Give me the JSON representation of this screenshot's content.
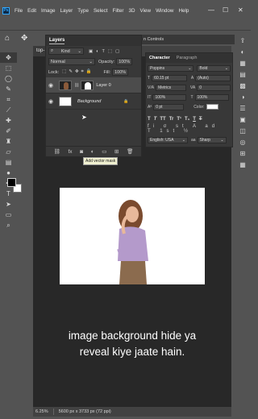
{
  "menubar": {
    "logo": "Ps",
    "items": [
      "File",
      "Edit",
      "Image",
      "Layer",
      "Type",
      "Select",
      "Filter",
      "3D",
      "View",
      "Window",
      "Help"
    ],
    "controls": [
      "—",
      "☐",
      "✕"
    ]
  },
  "optionsbar": {
    "icons": [
      "home-icon",
      "move-icon"
    ],
    "show_controls": "n Controls"
  },
  "document": {
    "tab_label": "top-",
    "caption_line1": "image background hide ya",
    "caption_line2": "reveal kiye jaate hain.",
    "zoom": "6.25%",
    "doc_info": "5600 px x 3733 px (72 ppi)"
  },
  "layers_panel": {
    "title": "Layers",
    "kind_label": "Kind",
    "blend_mode": "Normal",
    "opacity_label": "Opacity:",
    "opacity_value": "100%",
    "lock_label": "Lock:",
    "fill_label": "Fill:",
    "fill_value": "100%",
    "layers": [
      {
        "name": "Layer 0",
        "selected": true,
        "has_mask": true
      },
      {
        "name": "Background",
        "selected": false,
        "locked": true
      }
    ],
    "footer_icons": [
      "link-icon",
      "fx-icon",
      "mask-icon",
      "adjustment-icon",
      "group-icon",
      "new-layer-icon",
      "trash-icon"
    ],
    "tooltip": "Add vector mask"
  },
  "character_panel": {
    "tabs": [
      "Character",
      "Paragraph"
    ],
    "font_family": "Poppins",
    "font_style": "Bold",
    "font_size": "60.15 pt",
    "leading": "(Auto)",
    "kerning": "Metrics",
    "tracking": "0",
    "vertical_scale": "100%",
    "horizontal_scale": "100%",
    "baseline_shift": "0 pt",
    "color_label": "Color:",
    "format_buttons": [
      "T",
      "T",
      "TT",
      "Tr",
      "T¹",
      "T₁",
      "T",
      "T"
    ],
    "language": "English: USA",
    "antialias": "Sharp",
    "aa_label": "aa"
  },
  "colors": {
    "accent": "#31a8ff",
    "ui_bg": "#535353",
    "panel_bg": "#383838",
    "canvas_bg": "#282828"
  }
}
